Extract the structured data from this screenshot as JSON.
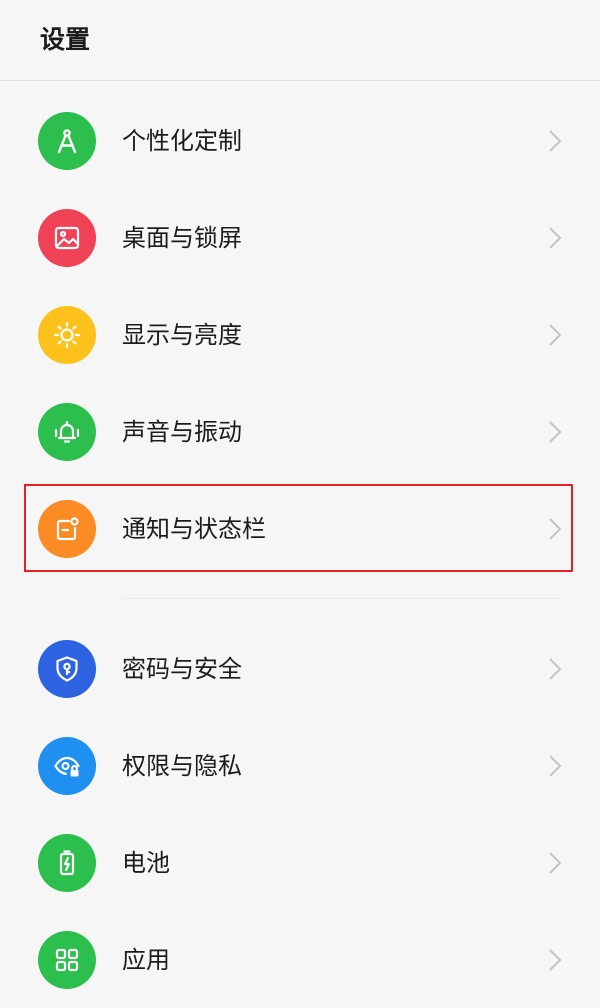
{
  "header": {
    "title": "设置"
  },
  "items": [
    {
      "label": "个性化定制",
      "icon": "compass-icon",
      "color": "#2dbf4d"
    },
    {
      "label": "桌面与锁屏",
      "icon": "wallpaper-image-icon",
      "color": "#ef4257"
    },
    {
      "label": "显示与亮度",
      "icon": "sun-brightness-icon",
      "color": "#fcc21b"
    },
    {
      "label": "声音与振动",
      "icon": "bell-vibrate-icon",
      "color": "#2dbf4d"
    },
    {
      "label": "通知与状态栏",
      "icon": "notification-badge-icon",
      "color": "#fb8b24"
    },
    {
      "label": "密码与安全",
      "icon": "shield-key-icon",
      "color": "#2d63e0"
    },
    {
      "label": "权限与隐私",
      "icon": "eye-lock-icon",
      "color": "#1f8ff0"
    },
    {
      "label": "电池",
      "icon": "battery-charging-icon",
      "color": "#2dbf4d"
    },
    {
      "label": "应用",
      "icon": "apps-grid-icon",
      "color": "#2dbf4d"
    }
  ],
  "highlight": {
    "color": "#e02424",
    "item": "通知与状态栏"
  }
}
